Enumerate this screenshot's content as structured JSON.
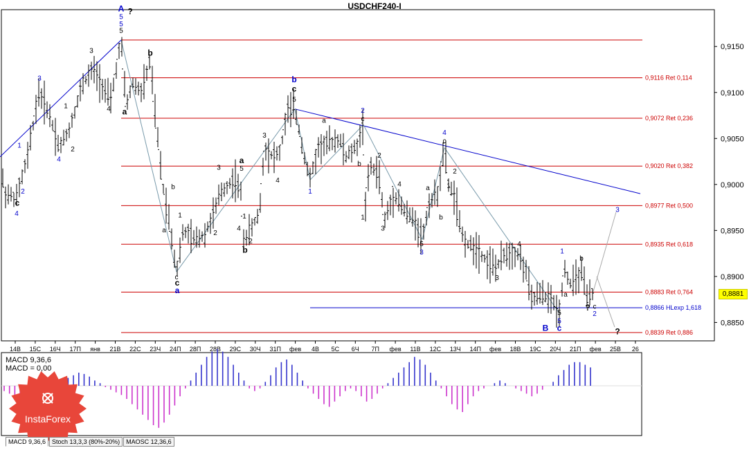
{
  "title": "USDCHF240-I",
  "current_price": "0,8881",
  "chart_data": {
    "type": "line",
    "title": "USDCHF240-I",
    "ylim": [
      0.883,
      0.919
    ],
    "y_ticks": [
      "0,9150",
      "0,9100",
      "0,9050",
      "0,9000",
      "0,8950",
      "0,8900",
      "0,8850"
    ],
    "y_tick_values": [
      0.915,
      0.91,
      0.905,
      0.9,
      0.895,
      0.89,
      0.885
    ],
    "x_ticks": [
      "14В",
      "15С",
      "16Ч",
      "17П",
      "янв",
      "21В",
      "22С",
      "23Ч",
      "24П",
      "28П",
      "28В",
      "29С",
      "30Ч",
      "31П",
      "фев",
      "4В",
      "5С",
      "6Ч",
      "7П",
      "фев",
      "11В",
      "12С",
      "13Ч",
      "14П",
      "фев",
      "18В",
      "19С",
      "20Ч",
      "21П",
      "фев",
      "25В",
      "26"
    ],
    "levels": [
      {
        "value": 0.9157,
        "label": ""
      },
      {
        "value": 0.9116,
        "label": "0,9116 Ret 0,114"
      },
      {
        "value": 0.9072,
        "label": "0,9072 Ret 0,236"
      },
      {
        "value": 0.902,
        "label": "0,9020 Ret 0,382"
      },
      {
        "value": 0.8977,
        "label": "0,8977 Ret 0,500"
      },
      {
        "value": 0.8935,
        "label": "0,8935 Ret 0,618"
      },
      {
        "value": 0.8883,
        "label": "0,8883 Ret 0,764"
      },
      {
        "value": 0.8866,
        "label": "0,8866 HLexp 1,618"
      },
      {
        "value": 0.8839,
        "label": "0,8839 Ret 0,886"
      }
    ],
    "price_path": [
      [
        0,
        0.902
      ],
      [
        8,
        0.899
      ],
      [
        24,
        0.8985
      ],
      [
        40,
        0.903
      ],
      [
        56,
        0.91
      ],
      [
        70,
        0.908
      ],
      [
        86,
        0.904
      ],
      [
        100,
        0.906
      ],
      [
        120,
        0.911
      ],
      [
        135,
        0.9125
      ],
      [
        150,
        0.9105
      ],
      [
        160,
        0.909
      ],
      [
        175,
        0.9157
      ],
      [
        182,
        0.9085
      ],
      [
        192,
        0.911
      ],
      [
        205,
        0.91
      ],
      [
        217,
        0.9135
      ],
      [
        225,
        0.907
      ],
      [
        235,
        0.9
      ],
      [
        245,
        0.896
      ],
      [
        255,
        0.8905
      ],
      [
        265,
        0.895
      ],
      [
        280,
        0.894
      ],
      [
        295,
        0.8945
      ],
      [
        310,
        0.897
      ],
      [
        318,
        0.899
      ],
      [
        330,
        0.9
      ],
      [
        340,
        0.9005
      ],
      [
        348,
        0.899
      ],
      [
        352,
        0.894
      ],
      [
        362,
        0.895
      ],
      [
        375,
        0.897
      ],
      [
        382,
        0.904
      ],
      [
        395,
        0.903
      ],
      [
        405,
        0.9035
      ],
      [
        415,
        0.908
      ],
      [
        426,
        0.9082
      ],
      [
        440,
        0.903
      ],
      [
        448,
        0.9005
      ],
      [
        460,
        0.904
      ],
      [
        475,
        0.9045
      ],
      [
        490,
        0.905
      ],
      [
        500,
        0.903
      ],
      [
        515,
        0.904
      ],
      [
        525,
        0.9065
      ],
      [
        528,
        0.898
      ],
      [
        535,
        0.902
      ],
      [
        548,
        0.901
      ],
      [
        555,
        0.896
      ],
      [
        570,
        0.899
      ],
      [
        585,
        0.897
      ],
      [
        600,
        0.896
      ],
      [
        610,
        0.894
      ],
      [
        620,
        0.898
      ],
      [
        632,
        0.899
      ],
      [
        642,
        0.904
      ],
      [
        648,
        0.9
      ],
      [
        658,
        0.8985
      ],
      [
        665,
        0.895
      ],
      [
        675,
        0.8935
      ],
      [
        690,
        0.893
      ],
      [
        705,
        0.8915
      ],
      [
        718,
        0.891
      ],
      [
        730,
        0.8925
      ],
      [
        748,
        0.8925
      ],
      [
        760,
        0.8905
      ],
      [
        768,
        0.8875
      ],
      [
        780,
        0.888
      ],
      [
        795,
        0.8876
      ],
      [
        808,
        0.886
      ],
      [
        815,
        0.891
      ],
      [
        825,
        0.889
      ],
      [
        840,
        0.8905
      ],
      [
        848,
        0.8875
      ],
      [
        856,
        0.8881
      ]
    ],
    "trendlines": [
      {
        "from": [
          0,
          0.903
        ],
        "to": [
          175,
          0.9157
        ],
        "color": "#0000cc"
      },
      {
        "from": [
          426,
          0.9082
        ],
        "to": [
          925,
          0.899
        ],
        "color": "#0000cc"
      },
      {
        "from": [
          175,
          0.9157
        ],
        "to": [
          255,
          0.8905
        ],
        "color": "#7799aa"
      },
      {
        "from": [
          255,
          0.8905
        ],
        "to": [
          426,
          0.9082
        ],
        "color": "#7799aa"
      },
      {
        "from": [
          426,
          0.9082
        ],
        "to": [
          448,
          0.9005
        ],
        "color": "#7799aa"
      },
      {
        "from": [
          448,
          0.9005
        ],
        "to": [
          525,
          0.9065
        ],
        "color": "#7799aa"
      },
      {
        "from": [
          525,
          0.9065
        ],
        "to": [
          610,
          0.894
        ],
        "color": "#7799aa"
      },
      {
        "from": [
          610,
          0.894
        ],
        "to": [
          642,
          0.904
        ],
        "color": "#7799aa"
      },
      {
        "from": [
          642,
          0.904
        ],
        "to": [
          808,
          0.886
        ],
        "color": "#7799aa"
      }
    ],
    "projections": [
      {
        "from": [
          856,
          0.8881
        ],
        "to": [
          890,
          0.897
        ]
      },
      {
        "from": [
          862,
          0.89
        ],
        "to": [
          888,
          0.8845
        ]
      }
    ],
    "wave_labels": [
      {
        "t": "A",
        "x": 175,
        "y": 0.9188,
        "c": "#0000cc",
        "big": true
      },
      {
        "t": "5",
        "x": 175,
        "y": 0.918,
        "c": "#0000cc"
      },
      {
        "t": "5",
        "x": 175,
        "y": 0.9172,
        "c": "#0000cc"
      },
      {
        "t": "5",
        "x": 175,
        "y": 0.9165,
        "c": "#000"
      },
      {
        "t": "?",
        "x": 188,
        "y": 0.9185,
        "c": "#000",
        "big": true
      },
      {
        "t": "3",
        "x": 132,
        "y": 0.9143,
        "c": "#000"
      },
      {
        "t": "b",
        "x": 217,
        "y": 0.914,
        "c": "#000",
        "big": true
      },
      {
        "t": "3",
        "x": 57,
        "y": 0.9113,
        "c": "#0000cc"
      },
      {
        "t": "1",
        "x": 95,
        "y": 0.9083,
        "c": "#000"
      },
      {
        "t": "4",
        "x": 157,
        "y": 0.908,
        "c": "#000"
      },
      {
        "t": "a",
        "x": 180,
        "y": 0.9076,
        "c": "#000",
        "big": true
      },
      {
        "t": "2",
        "x": 105,
        "y": 0.9036,
        "c": "#000"
      },
      {
        "t": "1",
        "x": 28,
        "y": 0.904,
        "c": "#0000cc"
      },
      {
        "t": "4",
        "x": 85,
        "y": 0.9025,
        "c": "#0000cc"
      },
      {
        "t": "2",
        "x": 33,
        "y": 0.899,
        "c": "#0000cc"
      },
      {
        "t": "c",
        "x": 25,
        "y": 0.8977,
        "c": "#000",
        "big": true
      },
      {
        "t": "4",
        "x": 24,
        "y": 0.8966,
        "c": "#0000cc"
      },
      {
        "t": "b",
        "x": 250,
        "y": 0.8995,
        "c": "#000"
      },
      {
        "t": "1",
        "x": 260,
        "y": 0.8964,
        "c": "#000"
      },
      {
        "t": "a",
        "x": 237,
        "y": 0.8948,
        "c": "#000"
      },
      {
        "t": "c",
        "x": 255,
        "y": 0.8897,
        "c": "#000"
      },
      {
        "t": "c",
        "x": 256,
        "y": 0.889,
        "c": "#000",
        "big": true
      },
      {
        "t": "a",
        "x": 256,
        "y": 0.8882,
        "c": "#0000cc",
        "big": true
      },
      {
        "t": "3",
        "x": 316,
        "y": 0.9016,
        "c": "#000"
      },
      {
        "t": "a",
        "x": 349,
        "y": 0.9023,
        "c": "#000",
        "big": true
      },
      {
        "t": "5",
        "x": 349,
        "y": 0.9015,
        "c": "#000"
      },
      {
        "t": "3",
        "x": 382,
        "y": 0.9051,
        "c": "#000"
      },
      {
        "t": "4",
        "x": 401,
        "y": 0.9002,
        "c": "#000"
      },
      {
        "t": "2",
        "x": 311,
        "y": 0.8945,
        "c": "#000"
      },
      {
        "t": "1",
        "x": 353,
        "y": 0.8963,
        "c": "#000"
      },
      {
        "t": "4",
        "x": 345,
        "y": 0.895,
        "c": "#000"
      },
      {
        "t": "2",
        "x": 362,
        "y": 0.8936,
        "c": "#000"
      },
      {
        "t": "b",
        "x": 354,
        "y": 0.8926,
        "c": "#000",
        "big": true
      },
      {
        "t": "b",
        "x": 425,
        "y": 0.9111,
        "c": "#0000cc",
        "big": true
      },
      {
        "t": "c",
        "x": 425,
        "y": 0.9101,
        "c": "#000",
        "big": true
      },
      {
        "t": "5",
        "x": 425,
        "y": 0.909,
        "c": "#000"
      },
      {
        "t": "a",
        "x": 468,
        "y": 0.9067,
        "c": "#000"
      },
      {
        "t": "1",
        "x": 448,
        "y": 0.899,
        "c": "#0000cc"
      },
      {
        "t": "2",
        "x": 524,
        "y": 0.9078,
        "c": "#0000cc"
      },
      {
        "t": "c",
        "x": 524,
        "y": 0.9069,
        "c": "#000"
      },
      {
        "t": "b",
        "x": 519,
        "y": 0.902,
        "c": "#000"
      },
      {
        "t": "2",
        "x": 548,
        "y": 0.9029,
        "c": "#000"
      },
      {
        "t": "4",
        "x": 577,
        "y": 0.8998,
        "c": "#000"
      },
      {
        "t": "1",
        "x": 524,
        "y": 0.8962,
        "c": "#000"
      },
      {
        "t": "3",
        "x": 553,
        "y": 0.895,
        "c": "#000"
      },
      {
        "t": "5",
        "x": 609,
        "y": 0.8933,
        "c": "#000"
      },
      {
        "t": "3",
        "x": 609,
        "y": 0.8924,
        "c": "#0000cc"
      },
      {
        "t": "4",
        "x": 642,
        "y": 0.9054,
        "c": "#0000cc"
      },
      {
        "t": "c",
        "x": 642,
        "y": 0.9045,
        "c": "#000"
      },
      {
        "t": "2",
        "x": 657,
        "y": 0.9012,
        "c": "#000"
      },
      {
        "t": "a",
        "x": 618,
        "y": 0.8994,
        "c": "#000"
      },
      {
        "t": "1",
        "x": 648,
        "y": 0.8996,
        "c": "#000"
      },
      {
        "t": "b",
        "x": 637,
        "y": 0.8962,
        "c": "#000"
      },
      {
        "t": "4",
        "x": 750,
        "y": 0.8933,
        "c": "#000"
      },
      {
        "t": "3",
        "x": 718,
        "y": 0.8896,
        "c": "#000"
      },
      {
        "t": "1",
        "x": 812,
        "y": 0.8925,
        "c": "#0000cc"
      },
      {
        "t": "b",
        "x": 840,
        "y": 0.8917,
        "c": "#000"
      },
      {
        "t": "a",
        "x": 817,
        "y": 0.8878,
        "c": "#000"
      },
      {
        "t": "?",
        "x": 849,
        "y": 0.8863,
        "c": "#000",
        "big": true
      },
      {
        "t": "c",
        "x": 859,
        "y": 0.8865,
        "c": "#000"
      },
      {
        "t": "2",
        "x": 859,
        "y": 0.8857,
        "c": "#0000cc"
      },
      {
        "t": "5",
        "x": 808,
        "y": 0.8858,
        "c": "#000"
      },
      {
        "t": "5",
        "x": 808,
        "y": 0.8849,
        "c": "#0000cc"
      },
      {
        "t": "c",
        "x": 808,
        "y": 0.8841,
        "c": "#0000cc",
        "big": true
      },
      {
        "t": "B",
        "x": 788,
        "y": 0.8841,
        "c": "#0000cc",
        "big": true
      },
      {
        "t": "3",
        "x": 892,
        "y": 0.897,
        "c": "#0000cc"
      },
      {
        "t": "?",
        "x": 892,
        "y": 0.8837,
        "c": "#000",
        "big": true
      }
    ]
  },
  "macd": {
    "label1": "MACD 9,36,6",
    "label2": "MACD = 0,00",
    "values": [
      -4,
      -6,
      -8,
      -6,
      -3,
      -1,
      2,
      4,
      5,
      3,
      2,
      4,
      6,
      8,
      10,
      9,
      7,
      4,
      2,
      -1,
      -3,
      -5,
      -7,
      -10,
      -14,
      -18,
      -22,
      -26,
      -30,
      -32,
      -28,
      -22,
      -15,
      -8,
      -2,
      4,
      10,
      16,
      22,
      26,
      28,
      26,
      22,
      16,
      10,
      4,
      -2,
      -4,
      -2,
      3,
      8,
      14,
      18,
      20,
      16,
      10,
      4,
      -2,
      -6,
      -10,
      -14,
      -16,
      -12,
      -8,
      -4,
      -2,
      -4,
      -8,
      -12,
      -10,
      -6,
      -2,
      2,
      6,
      10,
      14,
      18,
      22,
      20,
      16,
      10,
      4,
      -2,
      -8,
      -14,
      -18,
      -20,
      -14,
      -8,
      -4,
      -2,
      0,
      2,
      4,
      2,
      0,
      -2,
      -4,
      -6,
      -8,
      -6,
      -3,
      0,
      3,
      8,
      12,
      16,
      18,
      18,
      16,
      14,
      10,
      6,
      2
    ]
  },
  "logo": {
    "text": "InstaForex"
  },
  "tabs": [
    "MACD 9,36,6",
    "Stoch 13,3,3 (80%-20%)",
    "MAOSC 12,36,6"
  ]
}
